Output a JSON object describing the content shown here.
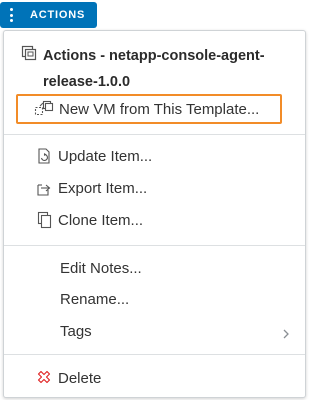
{
  "actions_button": {
    "label": "ACTIONS",
    "icon": "vertical-ellipsis-icon",
    "color": "#0073b8"
  },
  "menu": {
    "header": {
      "icon": "vm-template-icon",
      "title": "Actions - netapp-console-agent-release-1.0.0"
    },
    "items": [
      {
        "label": "New VM from This Template...",
        "icon": "new-vm-from-template-icon",
        "highlighted": true,
        "highlight_color": "#f28c28"
      },
      {
        "label": "Update Item...",
        "icon": "update-item-icon"
      },
      {
        "label": "Export Item...",
        "icon": "export-item-icon"
      },
      {
        "label": "Clone Item...",
        "icon": "clone-item-icon"
      },
      {
        "label": "Edit Notes..."
      },
      {
        "label": "Rename..."
      },
      {
        "label": "Tags",
        "icon": "chevron-right-icon",
        "has_submenu": true
      },
      {
        "label": "Delete",
        "icon": "delete-icon",
        "icon_color": "#e02020"
      }
    ]
  }
}
